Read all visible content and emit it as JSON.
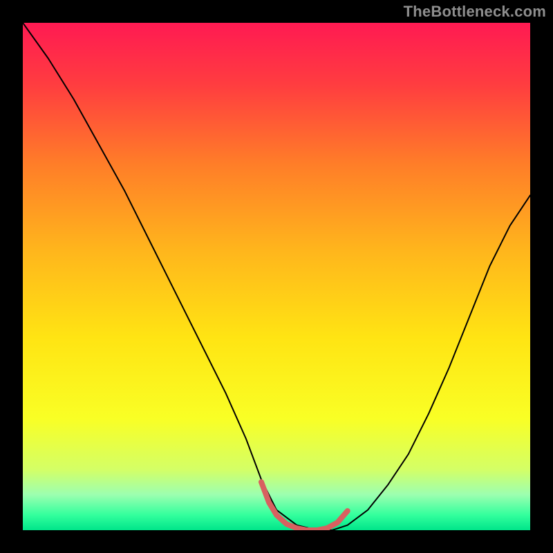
{
  "watermark": "TheBottleneck.com",
  "chart_data": {
    "type": "line",
    "title": "",
    "xlabel": "",
    "ylabel": "",
    "xlim": [
      0,
      1
    ],
    "ylim": [
      0,
      1
    ],
    "background_gradient": {
      "stops": [
        {
          "offset": 0.0,
          "color": "#ff1a52"
        },
        {
          "offset": 0.12,
          "color": "#ff3c40"
        },
        {
          "offset": 0.28,
          "color": "#ff7e28"
        },
        {
          "offset": 0.45,
          "color": "#ffb61c"
        },
        {
          "offset": 0.62,
          "color": "#ffe413"
        },
        {
          "offset": 0.78,
          "color": "#f9ff25"
        },
        {
          "offset": 0.88,
          "color": "#d4ff66"
        },
        {
          "offset": 0.93,
          "color": "#9cffb0"
        },
        {
          "offset": 0.97,
          "color": "#33ff9d"
        },
        {
          "offset": 1.0,
          "color": "#00e58a"
        }
      ]
    },
    "series": [
      {
        "name": "bottleneck-curve",
        "stroke": "#000000",
        "stroke_width": 2,
        "x": [
          0.0,
          0.05,
          0.1,
          0.15,
          0.2,
          0.25,
          0.3,
          0.35,
          0.4,
          0.44,
          0.47,
          0.5,
          0.54,
          0.58,
          0.61,
          0.64,
          0.68,
          0.72,
          0.76,
          0.8,
          0.84,
          0.88,
          0.92,
          0.96,
          1.0
        ],
        "y": [
          1.0,
          0.93,
          0.85,
          0.76,
          0.67,
          0.57,
          0.47,
          0.37,
          0.27,
          0.18,
          0.1,
          0.04,
          0.01,
          0.0,
          0.0,
          0.01,
          0.04,
          0.09,
          0.15,
          0.23,
          0.32,
          0.42,
          0.52,
          0.6,
          0.66
        ]
      },
      {
        "name": "minimum-highlight",
        "stroke": "#d86060",
        "stroke_width": 8,
        "x": [
          0.47,
          0.485,
          0.5,
          0.52,
          0.54,
          0.56,
          0.58,
          0.6,
          0.62,
          0.64
        ],
        "y": [
          0.095,
          0.055,
          0.03,
          0.012,
          0.004,
          0.0,
          0.0,
          0.004,
          0.015,
          0.038
        ]
      }
    ]
  }
}
